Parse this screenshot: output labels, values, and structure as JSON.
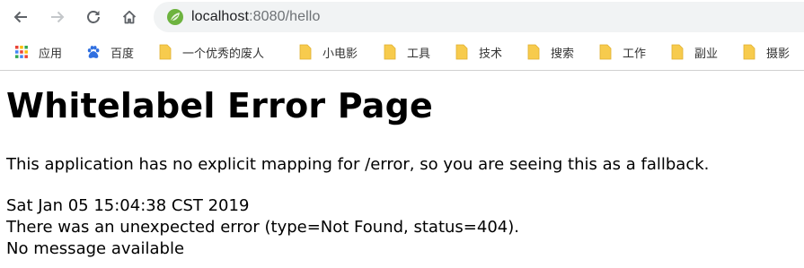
{
  "browser": {
    "url_host": "localhost",
    "url_rest": ":8080/hello",
    "icons": {
      "back": "arrow-left-icon",
      "forward": "arrow-right-icon",
      "reload": "reload-icon",
      "home": "home-icon",
      "site": "spring-leaf-icon"
    }
  },
  "bookmarks": [
    {
      "label": "应用",
      "icon": "apps-grid-icon"
    },
    {
      "label": "百度",
      "icon": "baidu-paw-icon"
    },
    {
      "label": "一个优秀的废人",
      "icon": "folder-icon"
    },
    {
      "label": "小电影",
      "icon": "folder-icon"
    },
    {
      "label": "工具",
      "icon": "folder-icon"
    },
    {
      "label": "技术",
      "icon": "folder-icon"
    },
    {
      "label": "搜索",
      "icon": "folder-icon"
    },
    {
      "label": "工作",
      "icon": "folder-icon"
    },
    {
      "label": "副业",
      "icon": "folder-icon"
    },
    {
      "label": "摄影",
      "icon": "folder-icon"
    }
  ],
  "page": {
    "title": "Whitelabel Error Page",
    "explanation": "This application has no explicit mapping for /error, so you are seeing this as a fallback.",
    "timestamp": "Sat Jan 05 15:04:38 CST 2019",
    "error": "There was an unexpected error (type=Not Found, status=404).",
    "message": "No message available"
  },
  "colors": {
    "folder": "#f7cb4d",
    "leaf": "#6db33f",
    "baidu": "#2f6fe0",
    "omnibox": "#f1f3f4"
  }
}
